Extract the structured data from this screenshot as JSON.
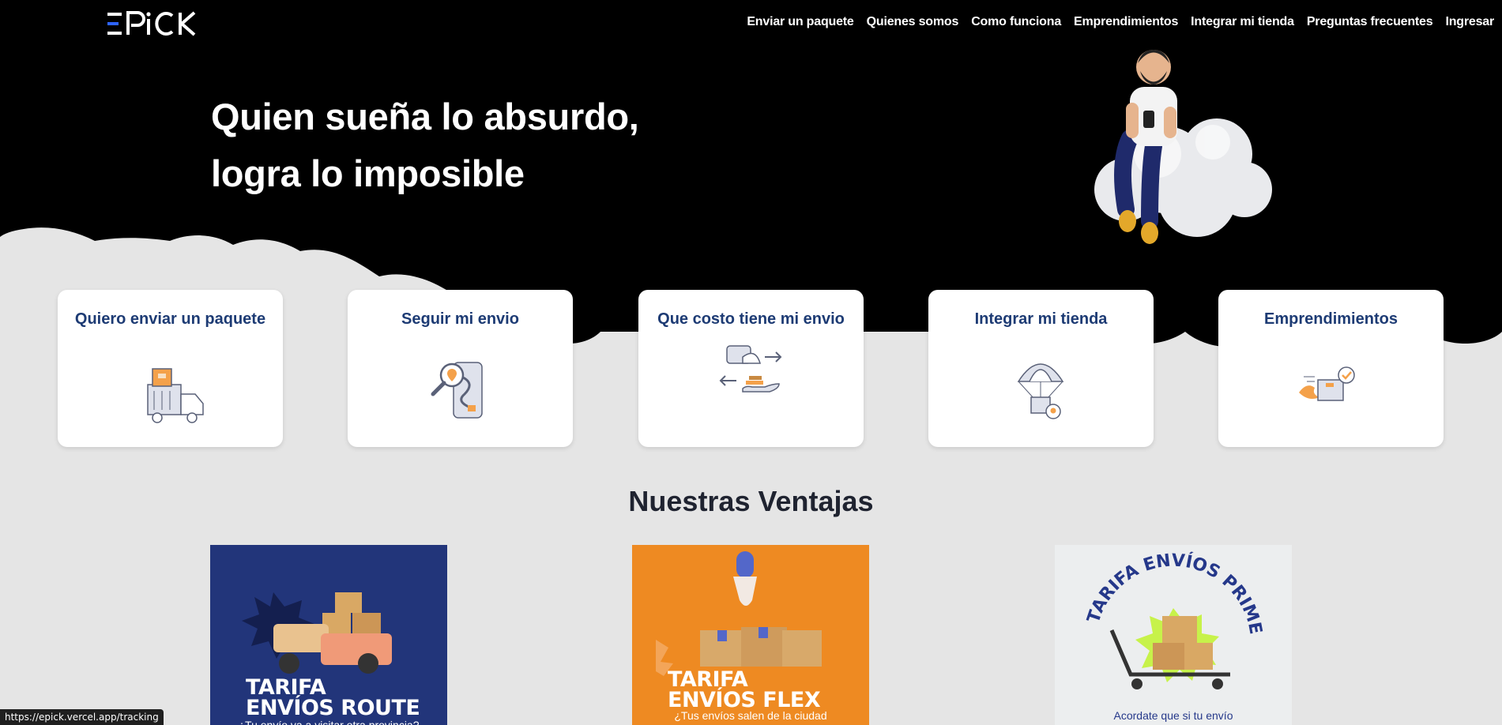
{
  "brand": {
    "logo_text": "EPiCK"
  },
  "nav": {
    "items": [
      "Enviar un paquete",
      "Quienes somos",
      "Como funciona",
      "Emprendimientos",
      "Integrar mi tienda",
      "Preguntas frecuentes",
      "Ingresar"
    ]
  },
  "hero": {
    "line1": "Quien sueña lo absurdo,",
    "line2": "logra lo imposible",
    "illustration_icon": "man-on-cloud-illustration"
  },
  "cards": [
    {
      "label": "Quiero enviar un paquete",
      "icon": "delivery-truck-icon"
    },
    {
      "label": "Seguir mi envio",
      "icon": "tracking-map-icon"
    },
    {
      "label": "Que costo tiene mi envio",
      "icon": "price-exchange-icon"
    },
    {
      "label": "Integrar mi tienda",
      "icon": "parachute-package-icon"
    },
    {
      "label": "Emprendimientos",
      "icon": "fast-package-icon"
    }
  ],
  "advantages": {
    "title": "Nuestras Ventajas",
    "promos": [
      {
        "title_line1": "TARIFA",
        "title_line2": "ENVÍOS ROUTE",
        "subtitle": "¿Tu envío va a visitar otra provincia?",
        "bg": "#22357a"
      },
      {
        "title_line1": "TARIFA",
        "title_line2": "ENVÍOS FLEX",
        "subtitle": "¿Tus envíos salen de la ciudad",
        "bg": "#ee8a22"
      },
      {
        "title_arc": "TARIFA ENVÍOS PRIME",
        "subtitle": "Acordate que si tu envío",
        "bg": "#eceeef"
      }
    ]
  },
  "status_bar": {
    "url": "https://epick.vercel.app/tracking"
  },
  "colors": {
    "primary": "#1d3b74",
    "accent_orange": "#ee8a22",
    "hero_bg": "#000000",
    "page_bg": "#e5e5e5"
  }
}
